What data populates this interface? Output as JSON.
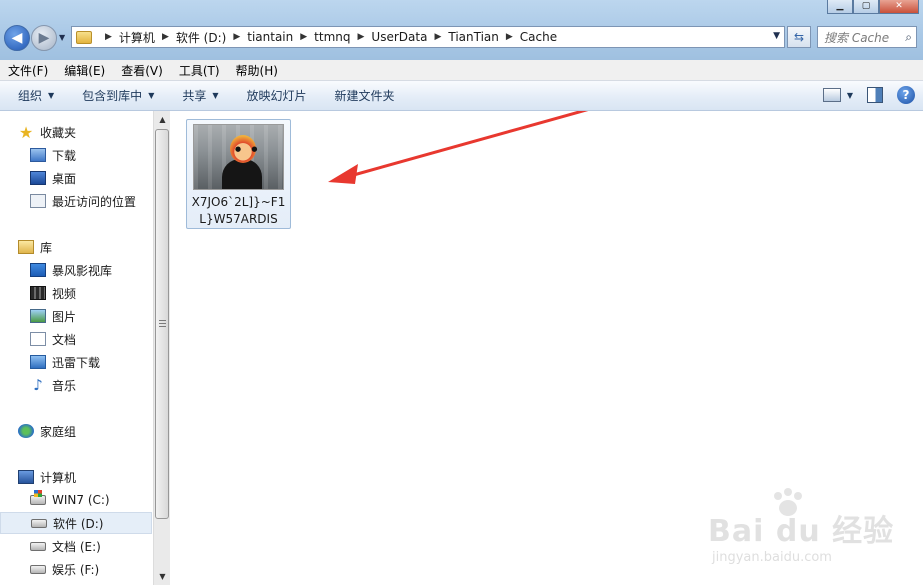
{
  "address": {
    "breadcrumbs": [
      "计算机",
      "软件 (D:)",
      "tiantain",
      "ttmnq",
      "UserData",
      "TianTian",
      "Cache"
    ]
  },
  "search": {
    "placeholder": "搜索 Cache"
  },
  "menu": [
    "文件(F)",
    "编辑(E)",
    "查看(V)",
    "工具(T)",
    "帮助(H)"
  ],
  "toolbar": {
    "organize": "组织",
    "include_library": "包含到库中",
    "share": "共享",
    "slideshow": "放映幻灯片",
    "new_folder": "新建文件夹"
  },
  "nav": {
    "favorites": {
      "label": "收藏夹",
      "items": [
        "下载",
        "桌面",
        "最近访问的位置"
      ]
    },
    "libraries": {
      "label": "库",
      "items": [
        "暴风影视库",
        "视频",
        "图片",
        "文档",
        "迅雷下载",
        "音乐"
      ]
    },
    "homegroup": {
      "label": "家庭组"
    },
    "computer": {
      "label": "计算机",
      "items": [
        "WIN7 (C:)",
        "软件 (D:)",
        "文档 (E:)",
        "娱乐 (F:)"
      ],
      "selected": "软件 (D:)"
    }
  },
  "files": [
    {
      "name": "X7JO6`2L]}~F1L}W57ARDIS",
      "type": "image"
    }
  ],
  "watermark": {
    "brand": "Bai du 经验",
    "url": "jingyan.baidu.com"
  },
  "colors": {
    "accent": "#1e395b",
    "arrow": "#e8382f",
    "selection": "#e5eef8"
  }
}
